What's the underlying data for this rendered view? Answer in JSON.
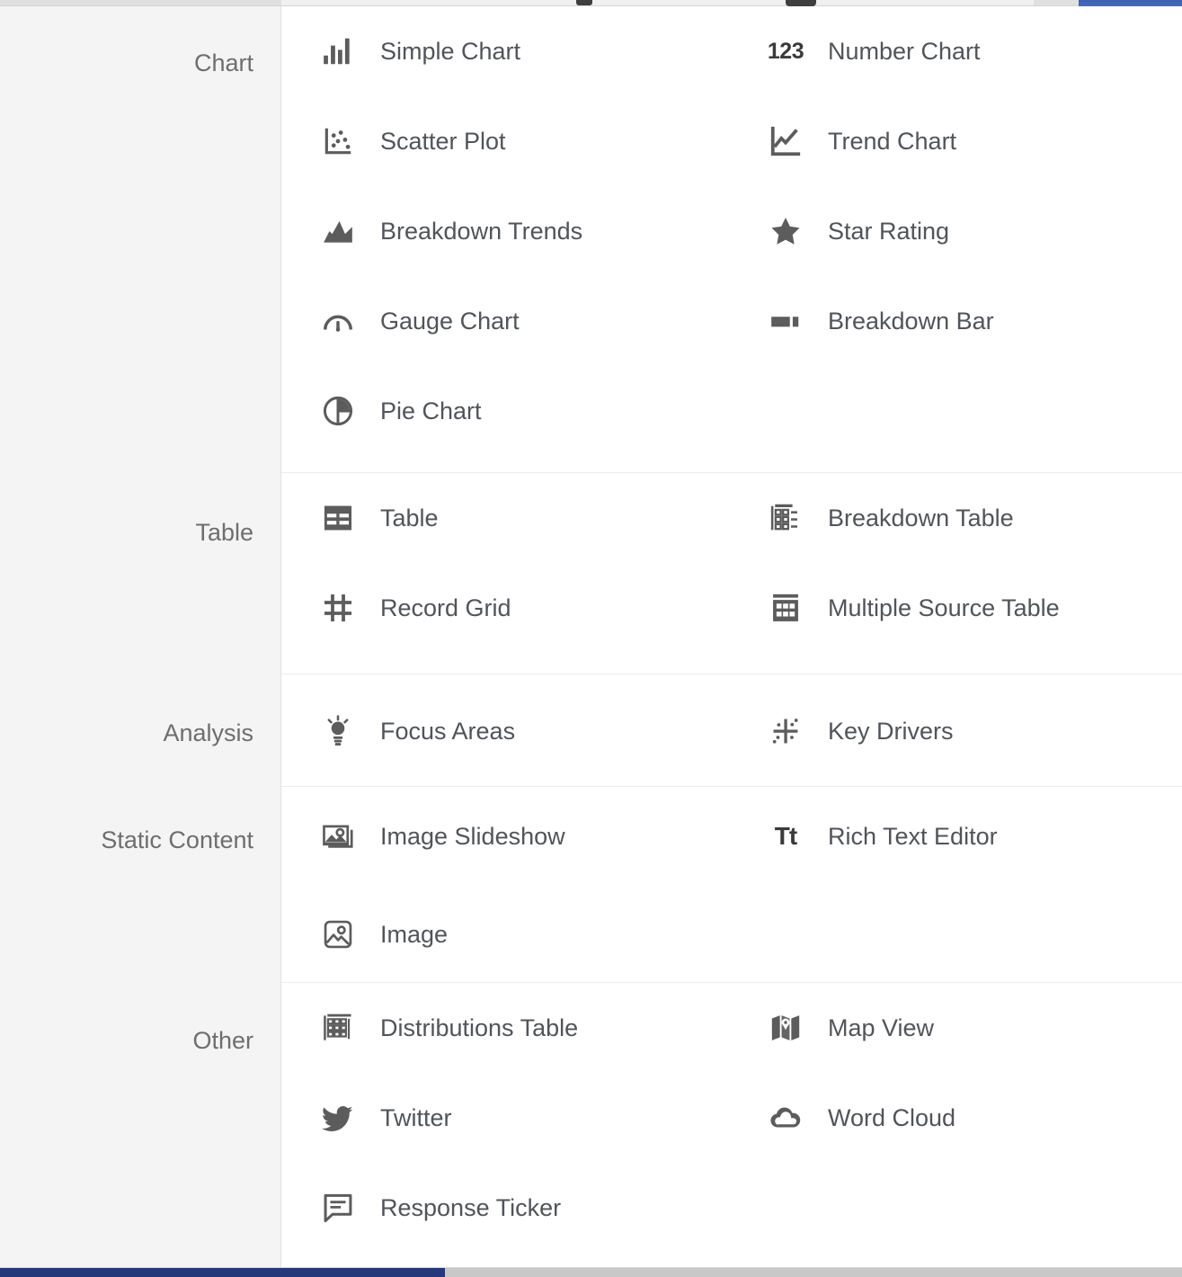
{
  "window": {
    "accent_blue": "#3c5fb0",
    "scrollbar_thumb_color": "#25387a",
    "icon_color": "#5c5c5c",
    "label_color": "#515459",
    "group_label_color": "#6e6e6e",
    "rail_background": "#f4f4f4"
  },
  "panel": {
    "groups": [
      {
        "label": "Chart",
        "items": [
          {
            "label": "Simple Chart",
            "icon": "bar-chart-icon",
            "column": "left"
          },
          {
            "label": "Number Chart",
            "icon": "number-123-icon",
            "column": "right"
          },
          {
            "label": "Scatter Plot",
            "icon": "scatter-plot-icon",
            "column": "left"
          },
          {
            "label": "Trend Chart",
            "icon": "line-chart-icon",
            "column": "right"
          },
          {
            "label": "Breakdown Trends",
            "icon": "area-chart-icon",
            "column": "left"
          },
          {
            "label": "Star Rating",
            "icon": "star-icon",
            "column": "right"
          },
          {
            "label": "Gauge Chart",
            "icon": "gauge-icon",
            "column": "left"
          },
          {
            "label": "Breakdown Bar",
            "icon": "stacked-bar-icon",
            "column": "right"
          },
          {
            "label": "Pie Chart",
            "icon": "pie-chart-icon",
            "column": "left"
          }
        ]
      },
      {
        "label": "Table",
        "items": [
          {
            "label": "Table",
            "icon": "table-icon",
            "column": "left"
          },
          {
            "label": "Breakdown Table",
            "icon": "breakdown-table-icon",
            "column": "right"
          },
          {
            "label": "Record Grid",
            "icon": "grid-icon",
            "column": "left"
          },
          {
            "label": "Multiple Source Table",
            "icon": "multi-table-icon",
            "column": "right"
          }
        ]
      },
      {
        "label": "Analysis",
        "items": [
          {
            "label": "Focus Areas",
            "icon": "lightbulb-icon",
            "column": "left"
          },
          {
            "label": "Key Drivers",
            "icon": "key-drivers-icon",
            "column": "right"
          }
        ]
      },
      {
        "label": "Static Content",
        "items": [
          {
            "label": "Image Slideshow",
            "icon": "image-stack-icon",
            "column": "left"
          },
          {
            "label": "Rich Text Editor",
            "icon": "text-format-icon",
            "column": "right"
          },
          {
            "label": "Image",
            "icon": "image-icon",
            "column": "left"
          }
        ]
      },
      {
        "label": "Other",
        "items": [
          {
            "label": "Distributions Table",
            "icon": "distributions-table-icon",
            "column": "left"
          },
          {
            "label": "Map View",
            "icon": "map-icon",
            "column": "right"
          },
          {
            "label": "Twitter",
            "icon": "twitter-bird-icon",
            "column": "left"
          },
          {
            "label": "Word Cloud",
            "icon": "cloud-icon",
            "column": "right"
          },
          {
            "label": "Response Ticker",
            "icon": "comment-lines-icon",
            "column": "left"
          }
        ]
      }
    ]
  },
  "icon_glyphs": {
    "number_123": "123",
    "text_format": "Tt"
  }
}
